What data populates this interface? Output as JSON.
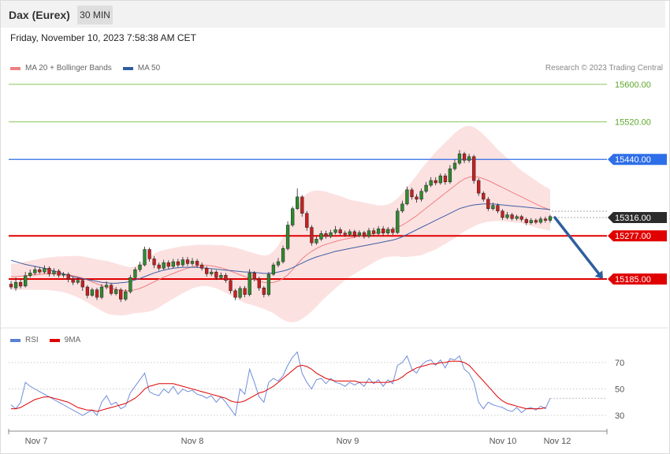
{
  "header": {
    "instrument": "Dax (Eurex)",
    "interval": "30 MIN",
    "datetime": "Friday, November 10, 2023 7:58:38 AM CET"
  },
  "legend_main": [
    {
      "label": "MA 20 + Bollinger Bands",
      "color": "#f08080"
    },
    {
      "label": "MA 50",
      "color": "#2e5e9e"
    }
  ],
  "legend_rsi": [
    {
      "label": "RSI",
      "color": "#5b7fd4"
    },
    {
      "label": "9MA",
      "color": "#e00000"
    }
  ],
  "copyright": "Research © 2023 Trading Central",
  "chart_data": {
    "type": "candlestick",
    "price_range": [
      15060,
      15650
    ],
    "levels": [
      {
        "value": 15600.0,
        "label": "15600.00",
        "role": "target",
        "color": "#8ac45c"
      },
      {
        "value": 15520.0,
        "label": "15520.00",
        "role": "target",
        "color": "#8ac45c"
      },
      {
        "value": 15440.0,
        "label": "15440.00",
        "role": "resistance",
        "color": "#2e6ee8"
      },
      {
        "value": 15316.0,
        "label": "15316.00",
        "role": "last-price",
        "color": "#2b2b2b"
      },
      {
        "value": 15277.0,
        "label": "15277.00",
        "role": "pivot",
        "color": "#e00000"
      },
      {
        "value": 15185.0,
        "label": "15185.00",
        "role": "support",
        "color": "#e00000"
      }
    ],
    "forecast_arrow": {
      "from": 15316,
      "to": 15185
    },
    "x_labels": [
      "Nov 7",
      "Nov 8",
      "Nov 9",
      "Nov 10",
      "Nov 12"
    ],
    "candles": [
      [
        15174,
        15168,
        15181,
        15163
      ],
      [
        15166,
        15178,
        15188,
        15160
      ],
      [
        15178,
        15170,
        15185,
        15165
      ],
      [
        15170,
        15192,
        15200,
        15167
      ],
      [
        15192,
        15198,
        15205,
        15188
      ],
      [
        15198,
        15205,
        15212,
        15193
      ],
      [
        15205,
        15200,
        15210,
        15196
      ],
      [
        15200,
        15208,
        15214,
        15196
      ],
      [
        15208,
        15196,
        15212,
        15190
      ],
      [
        15196,
        15202,
        15208,
        15191
      ],
      [
        15202,
        15193,
        15206,
        15188
      ],
      [
        15193,
        15195,
        15200,
        15188
      ],
      [
        15195,
        15185,
        15199,
        15178
      ],
      [
        15185,
        15178,
        15190,
        15172
      ],
      [
        15178,
        15182,
        15188,
        15174
      ],
      [
        15182,
        15168,
        15186,
        15160
      ],
      [
        15168,
        15150,
        15172,
        15144
      ],
      [
        15150,
        15162,
        15166,
        15147
      ],
      [
        15162,
        15146,
        15166,
        15140
      ],
      [
        15146,
        15168,
        15174,
        15142
      ],
      [
        15168,
        15172,
        15180,
        15163
      ],
      [
        15172,
        15154,
        15176,
        15150
      ],
      [
        15154,
        15162,
        15168,
        15150
      ],
      [
        15162,
        15142,
        15166,
        15136
      ],
      [
        15142,
        15158,
        15163,
        15138
      ],
      [
        15158,
        15188,
        15194,
        15154
      ],
      [
        15188,
        15205,
        15210,
        15185
      ],
      [
        15205,
        15215,
        15222,
        15200
      ],
      [
        15215,
        15248,
        15254,
        15212
      ],
      [
        15248,
        15228,
        15252,
        15222
      ],
      [
        15228,
        15215,
        15234,
        15208
      ],
      [
        15215,
        15208,
        15220,
        15203
      ],
      [
        15208,
        15220,
        15226,
        15204
      ],
      [
        15220,
        15212,
        15225,
        15207
      ],
      [
        15212,
        15222,
        15228,
        15208
      ],
      [
        15222,
        15215,
        15228,
        15210
      ],
      [
        15215,
        15226,
        15232,
        15211
      ],
      [
        15226,
        15218,
        15232,
        15213
      ],
      [
        15218,
        15223,
        15230,
        15213
      ],
      [
        15223,
        15215,
        15228,
        15209
      ],
      [
        15215,
        15208,
        15220,
        15203
      ],
      [
        15208,
        15196,
        15212,
        15190
      ],
      [
        15196,
        15200,
        15206,
        15191
      ],
      [
        15200,
        15188,
        15204,
        15183
      ],
      [
        15188,
        15193,
        15199,
        15184
      ],
      [
        15193,
        15182,
        15198,
        15177
      ],
      [
        15182,
        15160,
        15186,
        15154
      ],
      [
        15160,
        15146,
        15164,
        15140
      ],
      [
        15146,
        15165,
        15170,
        15142
      ],
      [
        15165,
        15152,
        15170,
        15146
      ],
      [
        15152,
        15198,
        15206,
        15148
      ],
      [
        15198,
        15185,
        15202,
        15180
      ],
      [
        15185,
        15166,
        15190,
        15160
      ],
      [
        15166,
        15152,
        15170,
        15146
      ],
      [
        15152,
        15195,
        15200,
        15148
      ],
      [
        15195,
        15215,
        15220,
        15192
      ],
      [
        15215,
        15222,
        15230,
        15210
      ],
      [
        15222,
        15250,
        15256,
        15218
      ],
      [
        15250,
        15300,
        15308,
        15246
      ],
      [
        15300,
        15335,
        15340,
        15296
      ],
      [
        15335,
        15360,
        15378,
        15332
      ],
      [
        15360,
        15325,
        15364,
        15318
      ],
      [
        15325,
        15295,
        15330,
        15288
      ],
      [
        15295,
        15262,
        15300,
        15256
      ],
      [
        15262,
        15270,
        15276,
        15258
      ],
      [
        15270,
        15282,
        15288,
        15266
      ],
      [
        15282,
        15276,
        15288,
        15271
      ],
      [
        15276,
        15284,
        15290,
        15272
      ],
      [
        15284,
        15290,
        15298,
        15280
      ],
      [
        15290,
        15283,
        15295,
        15278
      ],
      [
        15283,
        15280,
        15288,
        15275
      ],
      [
        15280,
        15286,
        15291,
        15276
      ],
      [
        15286,
        15278,
        15290,
        15273
      ],
      [
        15278,
        15284,
        15289,
        15274
      ],
      [
        15284,
        15276,
        15288,
        15271
      ],
      [
        15276,
        15288,
        15294,
        15272
      ],
      [
        15288,
        15282,
        15294,
        15277
      ],
      [
        15282,
        15292,
        15298,
        15278
      ],
      [
        15292,
        15283,
        15298,
        15278
      ],
      [
        15283,
        15291,
        15296,
        15279
      ],
      [
        15291,
        15284,
        15296,
        15279
      ],
      [
        15284,
        15330,
        15336,
        15281
      ],
      [
        15330,
        15345,
        15352,
        15326
      ],
      [
        15345,
        15375,
        15382,
        15342
      ],
      [
        15375,
        15360,
        15380,
        15354
      ],
      [
        15360,
        15355,
        15366,
        15348
      ],
      [
        15355,
        15372,
        15378,
        15350
      ],
      [
        15372,
        15385,
        15392,
        15368
      ],
      [
        15385,
        15395,
        15402,
        15381
      ],
      [
        15395,
        15390,
        15402,
        15385
      ],
      [
        15390,
        15405,
        15410,
        15386
      ],
      [
        15405,
        15392,
        15410,
        15386
      ],
      [
        15392,
        15420,
        15428,
        15388
      ],
      [
        15420,
        15432,
        15440,
        15416
      ],
      [
        15432,
        15452,
        15460,
        15428
      ],
      [
        15452,
        15438,
        15456,
        15432
      ],
      [
        15438,
        15446,
        15452,
        15433
      ],
      [
        15446,
        15395,
        15450,
        15388
      ],
      [
        15395,
        15368,
        15400,
        15362
      ],
      [
        15368,
        15355,
        15372,
        15350
      ],
      [
        15355,
        15335,
        15360,
        15330
      ],
      [
        15335,
        15342,
        15348,
        15331
      ],
      [
        15342,
        15330,
        15346,
        15325
      ],
      [
        15330,
        15316,
        15334,
        15311
      ],
      [
        15316,
        15322,
        15328,
        15312
      ],
      [
        15322,
        15314,
        15326,
        15310
      ],
      [
        15314,
        15318,
        15322,
        15310
      ],
      [
        15318,
        15312,
        15322,
        15307
      ],
      [
        15312,
        15305,
        15316,
        15300
      ],
      [
        15305,
        15310,
        15315,
        15301
      ],
      [
        15310,
        15306,
        15314,
        15302
      ],
      [
        15306,
        15313,
        15318,
        15302
      ],
      [
        15313,
        15310,
        15318,
        15305
      ],
      [
        15310,
        15318,
        15322,
        15305
      ]
    ],
    "ma50": [
      15225,
      15222,
      15219,
      15216,
      15214,
      15212,
      15210,
      15208,
      15205,
      15202,
      15199,
      15196,
      15193,
      15190,
      15188,
      15186,
      15184,
      15182,
      15180,
      15178,
      15177,
      15176,
      15176,
      15177,
      15178,
      15180,
      15183,
      15186,
      15190,
      15194,
      15198,
      15201,
      15204,
      15206,
      15208,
      15209,
      15210,
      15210,
      15210,
      15210,
      15209,
      15208,
      15207,
      15206,
      15205,
      15204,
      15203,
      15202,
      15201,
      15200,
      15200,
      15199,
      15198,
      15197,
      15197,
      15198,
      15200,
      15202,
      15205,
      15209,
      15214,
      15219,
      15224,
      15228,
      15232,
      15235,
      15238,
      15241,
      15244,
      15246,
      15248,
      15250,
      15252,
      15254,
      15256,
      15258,
      15260,
      15262,
      15264,
      15266,
      15268,
      15271,
      15275,
      15280,
      15285,
      15290,
      15295,
      15300,
      15305,
      15310,
      15315,
      15320,
      15325,
      15330,
      15335,
      15338,
      15341,
      15343,
      15344,
      15345,
      15345,
      15345,
      15344,
      15343,
      15342,
      15341,
      15340,
      15339,
      15338,
      15337,
      15336,
      15335,
      15334,
      15333
    ],
    "ma20": [
      15190,
      15190,
      15191,
      15192,
      15193,
      15194,
      15195,
      15196,
      15196,
      15196,
      15196,
      15195,
      15194,
      15192,
      15190,
      15187,
      15183,
      15179,
      15175,
      15171,
      15168,
      15165,
      15163,
      15161,
      15160,
      15160,
      15162,
      15165,
      15169,
      15174,
      15179,
      15184,
      15189,
      15193,
      15197,
      15201,
      15205,
      15208,
      15211,
      15213,
      15214,
      15214,
      15213,
      15211,
      15209,
      15206,
      15202,
      15198,
      15194,
      15190,
      15187,
      15184,
      15181,
      15178,
      15177,
      15178,
      15181,
      15186,
      15194,
      15205,
      15217,
      15228,
      15237,
      15244,
      15250,
      15255,
      15259,
      15262,
      15265,
      15268,
      15270,
      15272,
      15274,
      15276,
      15278,
      15280,
      15282,
      15284,
      15286,
      15288,
      15291,
      15295,
      15300,
      15306,
      15313,
      15320,
      15328,
      15336,
      15344,
      15352,
      15360,
      15368,
      15376,
      15384,
      15392,
      15398,
      15402,
      15403,
      15402,
      15399,
      15395,
      15390,
      15385,
      15380,
      15375,
      15370,
      15365,
      15360,
      15355,
      15350,
      15345,
      15340,
      15336,
      15332
    ],
    "bb_width": [
      28,
      28,
      29,
      30,
      31,
      32,
      33,
      34,
      35,
      36,
      37,
      38,
      40,
      42,
      44,
      46,
      48,
      50,
      52,
      54,
      56,
      56,
      55,
      54,
      52,
      50,
      50,
      52,
      55,
      58,
      60,
      60,
      58,
      56,
      54,
      52,
      50,
      48,
      46,
      45,
      44,
      44,
      45,
      46,
      48,
      50,
      52,
      54,
      55,
      56,
      56,
      56,
      56,
      57,
      60,
      66,
      76,
      88,
      100,
      112,
      122,
      128,
      130,
      128,
      124,
      118,
      112,
      106,
      100,
      94,
      88,
      82,
      78,
      74,
      70,
      66,
      62,
      58,
      56,
      56,
      58,
      62,
      68,
      74,
      80,
      86,
      92,
      96,
      100,
      104,
      106,
      108,
      110,
      112,
      112,
      112,
      110,
      106,
      100,
      94,
      88,
      82,
      76,
      72,
      68,
      64,
      60,
      56,
      54,
      52,
      50,
      48,
      46,
      44
    ],
    "rsi": {
      "range": [
        20,
        80
      ],
      "ticks": [
        70,
        50,
        30
      ],
      "rsi": [
        38,
        35,
        40,
        55,
        52,
        50,
        48,
        46,
        44,
        42,
        40,
        38,
        36,
        34,
        32,
        30,
        32,
        34,
        30,
        40,
        45,
        38,
        40,
        35,
        37,
        47,
        52,
        57,
        62,
        48,
        46,
        45,
        50,
        47,
        52,
        46,
        50,
        48,
        49,
        46,
        45,
        43,
        45,
        40,
        44,
        40,
        35,
        30,
        50,
        46,
        65,
        55,
        44,
        40,
        55,
        58,
        56,
        60,
        68,
        74,
        78,
        62,
        55,
        50,
        57,
        58,
        54,
        58,
        55,
        54,
        52,
        55,
        53,
        55,
        52,
        58,
        54,
        57,
        52,
        57,
        54,
        68,
        70,
        75,
        65,
        62,
        68,
        71,
        72,
        68,
        72,
        66,
        73,
        72,
        75,
        65,
        62,
        55,
        40,
        35,
        40,
        38,
        37,
        36,
        34,
        33,
        36,
        32,
        35,
        36,
        34,
        37,
        35,
        43
      ],
      "ma9": [
        35,
        35,
        36,
        38,
        40,
        42,
        43,
        44,
        44,
        43,
        42,
        41,
        40,
        38,
        36,
        35,
        34,
        34,
        33,
        34,
        35,
        36,
        37,
        38,
        39,
        41,
        43,
        46,
        50,
        52,
        53,
        54,
        54,
        54,
        54,
        53,
        52,
        51,
        50,
        49,
        48,
        47,
        46,
        45,
        44,
        43,
        41,
        40,
        40,
        41,
        43,
        45,
        47,
        48,
        50,
        52,
        55,
        58,
        61,
        64,
        67,
        68,
        67,
        65,
        62,
        60,
        58,
        57,
        56,
        56,
        56,
        56,
        56,
        55,
        55,
        55,
        55,
        55,
        55,
        55,
        56,
        57,
        59,
        62,
        64,
        66,
        67,
        68,
        69,
        69,
        70,
        70,
        71,
        71,
        71,
        70,
        68,
        64,
        60,
        56,
        52,
        48,
        44,
        41,
        39,
        38,
        37,
        36,
        35,
        35,
        35,
        35,
        36
      ]
    }
  }
}
